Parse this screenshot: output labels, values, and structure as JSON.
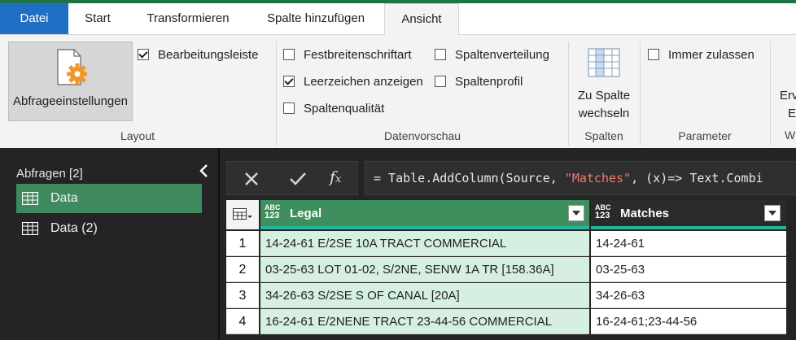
{
  "tabs": [
    "Datei",
    "Start",
    "Transformieren",
    "Spalte hinzufügen",
    "Ansicht"
  ],
  "active_tab": "Ansicht",
  "ribbon": {
    "layout": {
      "button_label": "Abfrageeinstellungen",
      "checkbox": {
        "label": "Bearbeitungsleiste",
        "checked": true
      },
      "group_label": "Layout"
    },
    "datenvorschau": {
      "checkboxes": [
        {
          "label": "Festbreitenschriftart",
          "checked": false
        },
        {
          "label": "Leerzeichen anzeigen",
          "checked": true
        },
        {
          "label": "Spaltenqualität",
          "checked": false
        },
        {
          "label": "Spaltenverteilung",
          "checked": false
        },
        {
          "label": "Spaltenprofil",
          "checked": false
        }
      ],
      "group_label": "Datenvorschau"
    },
    "spalten": {
      "button_label_1": "Zu Spalte",
      "button_label_2": "wechseln",
      "group_label": "Spalten"
    },
    "parameter": {
      "checkbox": {
        "label": "Immer zulassen",
        "checked": false
      },
      "group_label": "Parameter"
    },
    "cutoff": {
      "top": "Erv",
      "mid": "E",
      "bottom": "W"
    }
  },
  "queries": {
    "title": "Abfragen [2]",
    "items": [
      {
        "label": "Data",
        "selected": true
      },
      {
        "label": "Data (2)",
        "selected": false
      }
    ]
  },
  "formula": {
    "prefix": "= Table.AddColumn(Source, ",
    "string": "\"Matches\"",
    "suffix": ", (x)=> Text.Combi"
  },
  "grid": {
    "type_badge_top": "ABC",
    "type_badge_bottom": "123",
    "columns": [
      "Legal",
      "Matches"
    ],
    "rows": [
      {
        "n": "1",
        "legal": "14-24-61 E/2SE 10A TRACT COMMERCIAL",
        "matches": "14-24-61"
      },
      {
        "n": "2",
        "legal": "03-25-63 LOT 01-02, S/2NE, SENW 1A TR [158.36A]",
        "matches": "03-25-63"
      },
      {
        "n": "3",
        "legal": "34-26-63 S/2SE S OF CANAL [20A]",
        "matches": "34-26-63"
      },
      {
        "n": "4",
        "legal": "16-24-61 E/2NENE TRACT 23-44-56 COMMERCIAL",
        "matches": "16-24-61;23-44-56"
      }
    ]
  },
  "colors": {
    "accent_green": "#217346",
    "file_tab_blue": "#1f6fc5",
    "selected_query": "#3e8a5e",
    "legal_header": "#3f8e5d",
    "legal_cell": "#d5f0e0",
    "dark_bg": "#242424"
  }
}
